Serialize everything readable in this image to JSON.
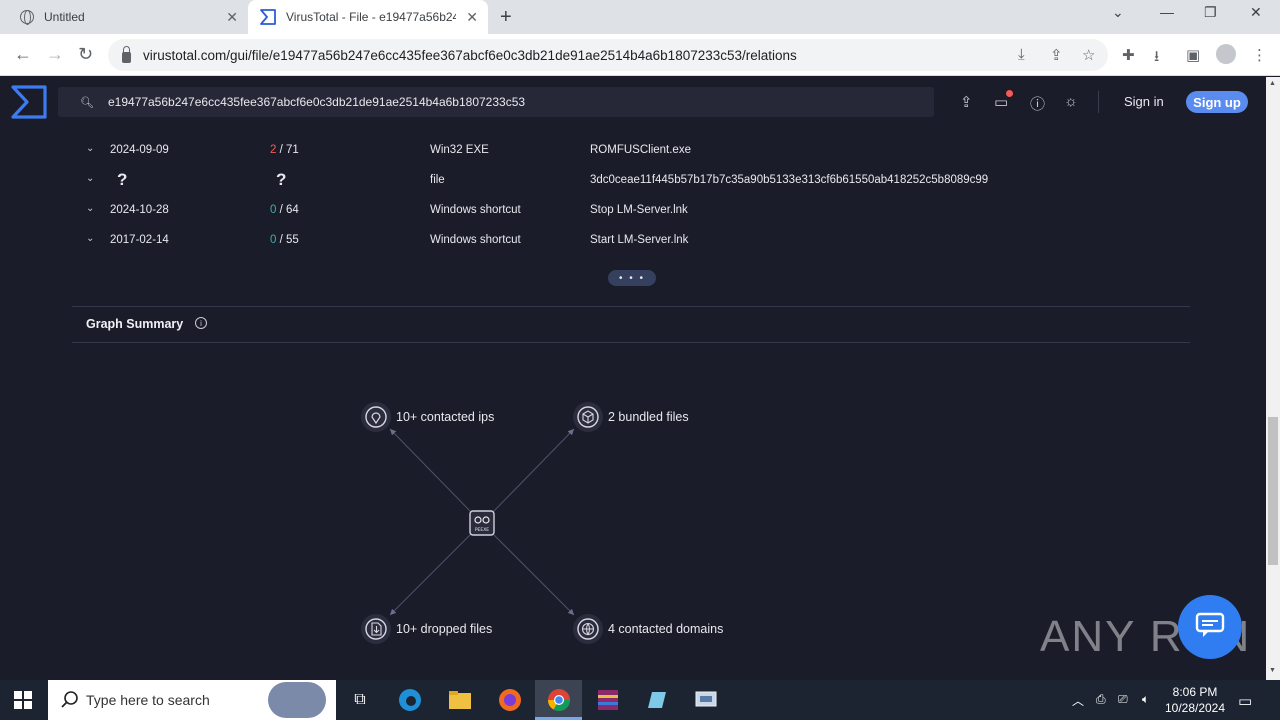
{
  "browser": {
    "tabs": [
      {
        "title": "Untitled",
        "active": false
      },
      {
        "title": "VirusTotal - File - e19477a56b247",
        "active": true
      }
    ],
    "new_tab_label": "+",
    "url": "virustotal.com/gui/file/e19477a56b247e6cc435fee367abcf6e0c3db21de91ae2514b4a6b1807233c53/relations"
  },
  "vt": {
    "search_value": "e19477a56b247e6cc435fee367abcf6e0c3db21de91ae2514b4a6b1807233c53",
    "sign_in": "Sign in",
    "sign_up": "Sign up"
  },
  "relations_rows": [
    {
      "date": "2024-09-09",
      "detections": "2",
      "total": "/ 71",
      "type": "Win32 EXE",
      "name": "ROMFUSClient.exe",
      "flag": "positive"
    },
    {
      "date": "?",
      "detections": "?",
      "total": "",
      "type": "file",
      "name": "3dc0ceae11f445b57b17b7c35a90b5133e313cf6b61550ab418252c5b8089c99",
      "flag": "unknown"
    },
    {
      "date": "2024-10-28",
      "detections": "0",
      "total": "/ 64",
      "type": "Windows shortcut",
      "name": "Stop LM-Server.lnk",
      "flag": "zero"
    },
    {
      "date": "2017-02-14",
      "detections": "0",
      "total": "/ 55",
      "type": "Windows shortcut",
      "name": "Start LM-Server.lnk",
      "flag": "zero"
    }
  ],
  "more_label": "• • •",
  "graph_summary": {
    "title": "Graph Summary",
    "info": "i",
    "center_label": "PEEXE",
    "nodes": [
      {
        "label": "10+ contacted ips",
        "icon": "location-pin-icon"
      },
      {
        "label": "2 bundled files",
        "icon": "package-box-icon"
      },
      {
        "label": "10+ dropped files",
        "icon": "file-download-icon"
      },
      {
        "label": "4 contacted domains",
        "icon": "globe-domain-icon"
      }
    ]
  },
  "watermark": "ANY RUN",
  "taskbar": {
    "search_placeholder": "Type here to search",
    "time": "8:06 PM",
    "date": "10/28/2024"
  },
  "colors": {
    "background": "#1b1c29",
    "accent": "#5a8cf0",
    "positive": "#f25c54",
    "zero": "#38b2ac"
  }
}
